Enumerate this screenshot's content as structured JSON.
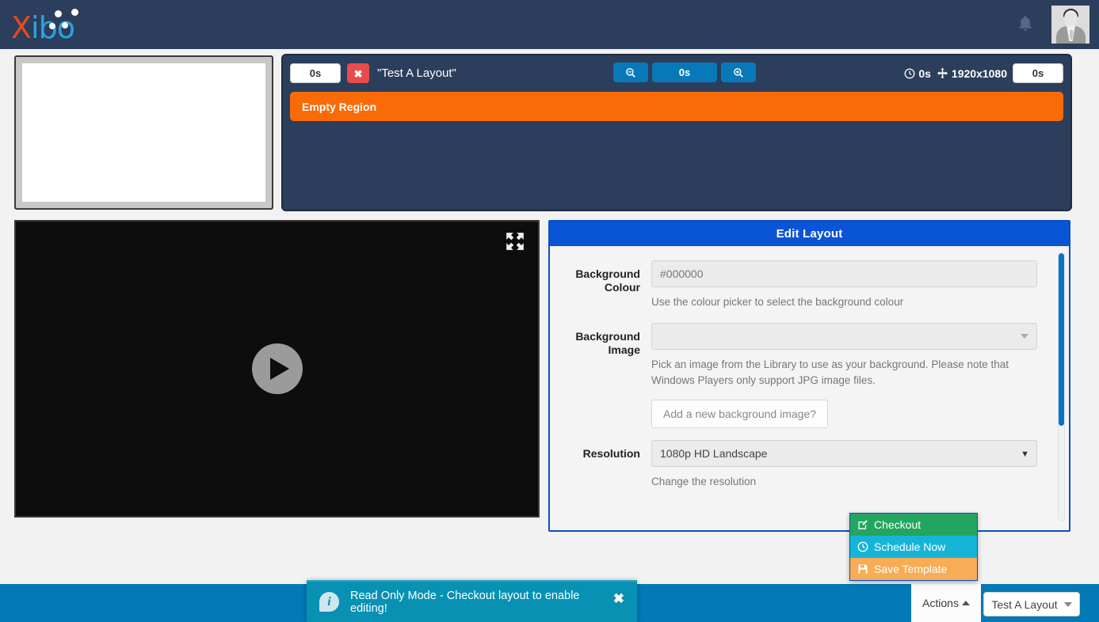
{
  "navbar": {
    "brand_x": "X",
    "brand_rest": "ibo",
    "bell_icon": "bell-icon",
    "avatar_alt": "user-avatar"
  },
  "timeline": {
    "left_duration": "0s",
    "delete_label": "✖",
    "layout_name": "\"Test A Layout\"",
    "zoom_out_icon": "zoom-out-icon",
    "zoom_duration": "0s",
    "zoom_in_icon": "zoom-in-icon",
    "clock_duration": "0s",
    "resolution": "1920x1080",
    "right_duration": "0s",
    "region_label": "Empty Region"
  },
  "preview": {
    "play_icon": "play-icon",
    "fullscreen_icon": "fullscreen-icon"
  },
  "form": {
    "title": "Edit Layout",
    "background_colour": {
      "label": "Background Colour",
      "value": "#000000",
      "help": "Use the colour picker to select the background colour"
    },
    "background_image": {
      "label": "Background Image",
      "value": "",
      "help": "Pick an image from the Library to use as your background. Please note that Windows Players only support JPG image files.",
      "add_button": "Add a new background image?"
    },
    "resolution": {
      "label": "Resolution",
      "value": "1080p HD Landscape",
      "help": "Change the resolution"
    }
  },
  "dropdown": {
    "items": [
      {
        "label": "Checkout",
        "icon": "edit-square-icon",
        "color": "#24a55f"
      },
      {
        "label": "Schedule Now",
        "icon": "clock-icon",
        "color": "#16b5d8"
      },
      {
        "label": "Save Template",
        "icon": "floppy-disk-icon",
        "color": "#f7ac55"
      }
    ]
  },
  "toast": {
    "icon": "info-icon",
    "message": "Read Only Mode - Checkout layout to enable editing!",
    "close": "✖"
  },
  "footer": {
    "actions_label": "Actions",
    "layout_button": "Test A Layout"
  }
}
